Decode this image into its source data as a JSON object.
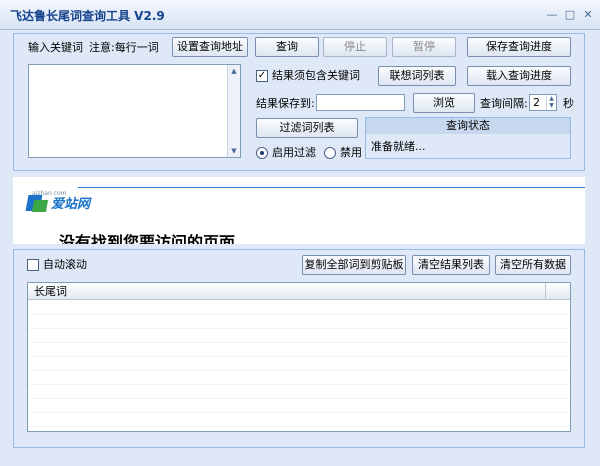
{
  "window": {
    "title": "飞达鲁长尾词查询工具 V2.9",
    "min_icon": "minimize-icon",
    "max_icon": "maximize-icon",
    "close_icon": "close-icon"
  },
  "top": {
    "input_label": "输入关键词",
    "note": "注意:每行一词",
    "buttons": {
      "set_url": "设置查询地址",
      "query": "查询",
      "stop": "停止",
      "pause": "暂停",
      "save_progress": "保存查询进度",
      "assoc_list": "联想词列表",
      "load_progress": "载入查询进度",
      "browse": "浏览",
      "filter_list": "过滤词列表"
    },
    "must_contain_label": "结果须包含关键词",
    "save_to_label": "结果保存到:",
    "save_to_value": "",
    "interval_label": "查询间隔:",
    "interval_value": "2",
    "interval_unit": "秒",
    "filter_on_label": "启用过滤",
    "filter_off_label": "禁用",
    "status_title": "查询状态",
    "status_text": "准备就绪..."
  },
  "browser": {
    "logo_small": "aizhan.com",
    "logo_text": "爱站网",
    "heading": "没有找到您要访问的页面"
  },
  "bottom": {
    "auto_scroll_label": "自动滚动",
    "copy_all": "复制全部词到剪贴板",
    "clear_results": "清空结果列表",
    "clear_all": "清空所有数据",
    "column_header": "长尾词",
    "rows": []
  },
  "colors": {
    "panel_bg": "#dfe8f6",
    "border": "#99bbe8",
    "title_text": "#15428b",
    "logo_blue": "#1a73c8",
    "logo_green": "#3aa845"
  }
}
